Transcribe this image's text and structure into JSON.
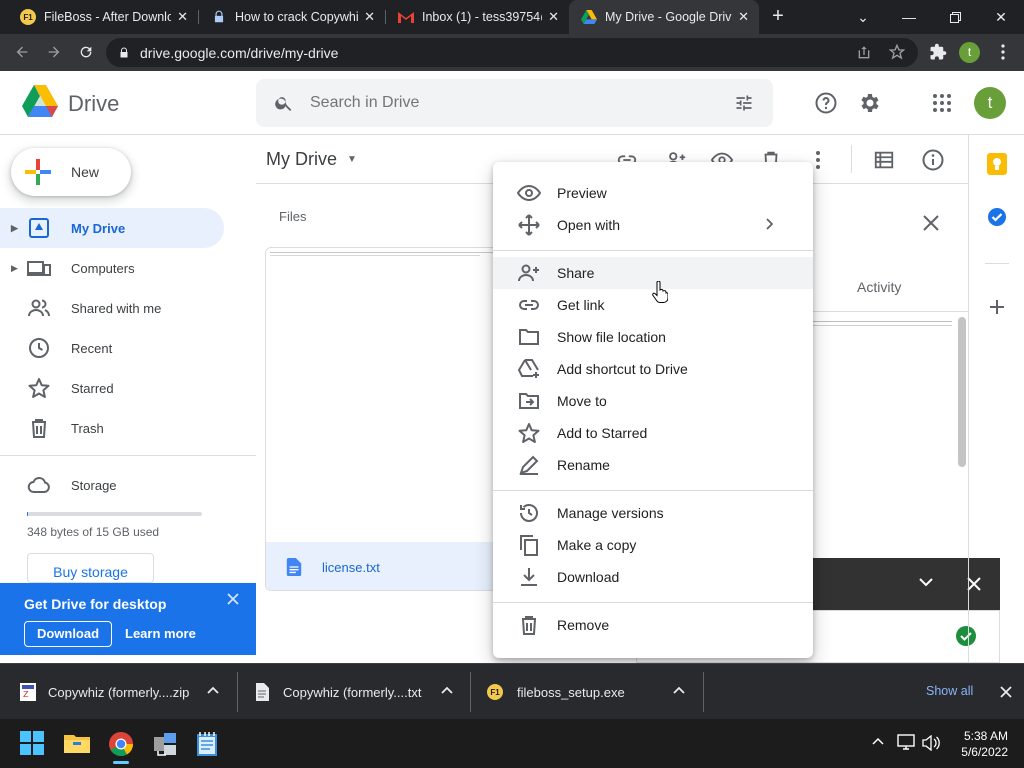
{
  "browser": {
    "tabs": [
      {
        "title": "FileBoss - After Downlo",
        "favicon": "fileboss-favicon"
      },
      {
        "title": "How to crack Copywhiz",
        "favicon": "lock-favicon"
      },
      {
        "title": "Inbox (1) - tess39754@",
        "favicon": "gmail-favicon"
      },
      {
        "title": "My Drive - Google Driv",
        "favicon": "drive-favicon",
        "active": true
      }
    ],
    "new_tab": "+",
    "address": "drive.google.com/drive/my-drive",
    "profile_initial": "t"
  },
  "header": {
    "app_name": "Drive",
    "search_placeholder": "Search in Drive",
    "avatar_initial": "t"
  },
  "sidebar": {
    "new_label": "New",
    "items": [
      {
        "label": "My Drive",
        "icon": "my-drive-icon",
        "selected": true
      },
      {
        "label": "Computers",
        "icon": "computers-icon"
      },
      {
        "label": "Shared with me",
        "icon": "shared-icon"
      },
      {
        "label": "Recent",
        "icon": "clock-icon"
      },
      {
        "label": "Starred",
        "icon": "star-icon"
      },
      {
        "label": "Trash",
        "icon": "trash-icon"
      }
    ],
    "storage_label": "Storage",
    "storage_used": "348 bytes of 15 GB used",
    "storage_fraction": 0.0001,
    "buy_storage": "Buy storage"
  },
  "content": {
    "title": "My Drive",
    "section_files": "Files",
    "file_name": "license.txt"
  },
  "details_panel": {
    "activity_label": "Activity"
  },
  "context_menu": {
    "items": [
      {
        "label": "Preview",
        "icon": "eye-icon"
      },
      {
        "label": "Open with",
        "icon": "open-with-icon",
        "submenu": true
      },
      {
        "label": "Share",
        "icon": "share-person-icon",
        "hover": true
      },
      {
        "label": "Get link",
        "icon": "link-icon"
      },
      {
        "label": "Show file location",
        "icon": "folder-icon"
      },
      {
        "label": "Add shortcut to Drive",
        "icon": "add-shortcut-icon"
      },
      {
        "label": "Move to",
        "icon": "move-to-icon"
      },
      {
        "label": "Add to Starred",
        "icon": "star-outline-icon"
      },
      {
        "label": "Rename",
        "icon": "rename-icon"
      },
      {
        "label": "Manage versions",
        "icon": "history-icon"
      },
      {
        "label": "Make a copy",
        "icon": "copy-icon"
      },
      {
        "label": "Download",
        "icon": "download-icon"
      },
      {
        "label": "Remove",
        "icon": "trash-icon"
      }
    ]
  },
  "promo": {
    "title": "Get Drive for desktop",
    "download": "Download",
    "learn_more": "Learn more"
  },
  "downloads": {
    "items": [
      {
        "name": "Copywhiz (formerly....zip"
      },
      {
        "name": "Copywhiz (formerly....txt"
      },
      {
        "name": "fileboss_setup.exe"
      }
    ],
    "show_all": "Show all"
  },
  "taskbar": {
    "time": "5:38 AM",
    "date": "5/6/2022"
  }
}
